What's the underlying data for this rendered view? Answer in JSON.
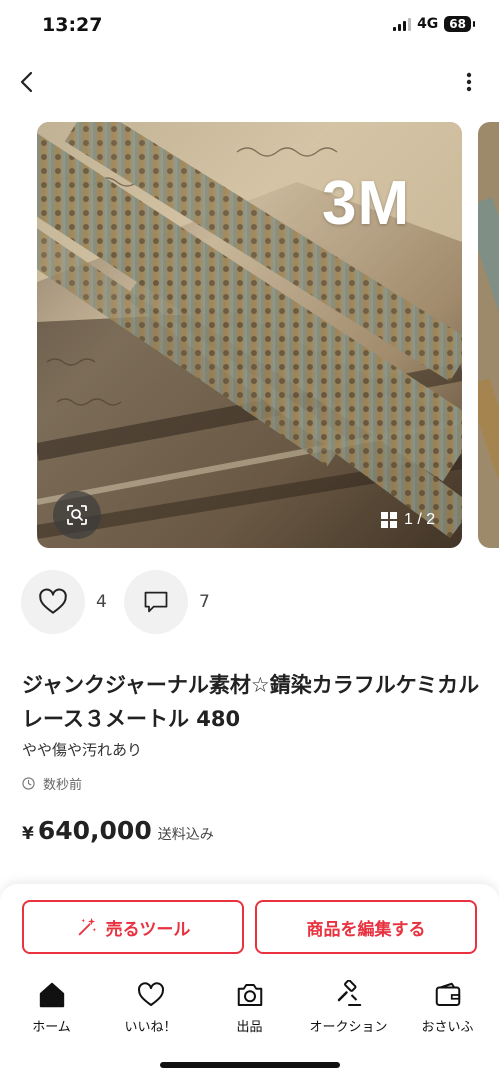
{
  "status_bar": {
    "time": "13:27",
    "network": "4G",
    "battery": "68"
  },
  "header": {
    "back_icon": "chevron-left-icon",
    "menu_icon": "more-vertical-icon"
  },
  "gallery": {
    "overlay_text": "3M",
    "counter": "1 / 2",
    "lens_icon": "image-search-icon",
    "grid_icon": "grid-icon"
  },
  "actions": {
    "likes": "4",
    "comments": "7"
  },
  "item": {
    "title": "ジャンクジャーナル素材☆錆染カラフルケミカルレース３メートル 480",
    "condition": "やや傷や汚れあり",
    "posted": "数秒前",
    "currency": "¥",
    "price": "640,000",
    "shipping": "送料込み"
  },
  "buttons": {
    "sell_tool": "売るツール",
    "edit": "商品を編集する"
  },
  "tabs": [
    {
      "label": "ホーム",
      "icon": "home-icon"
    },
    {
      "label": "いいね！",
      "icon": "heart-icon"
    },
    {
      "label": "出品",
      "icon": "camera-icon"
    },
    {
      "label": "オークション",
      "icon": "gavel-icon"
    },
    {
      "label": "おさいふ",
      "icon": "wallet-icon"
    }
  ],
  "colors": {
    "accent": "#e8323f",
    "text": "#222222"
  }
}
